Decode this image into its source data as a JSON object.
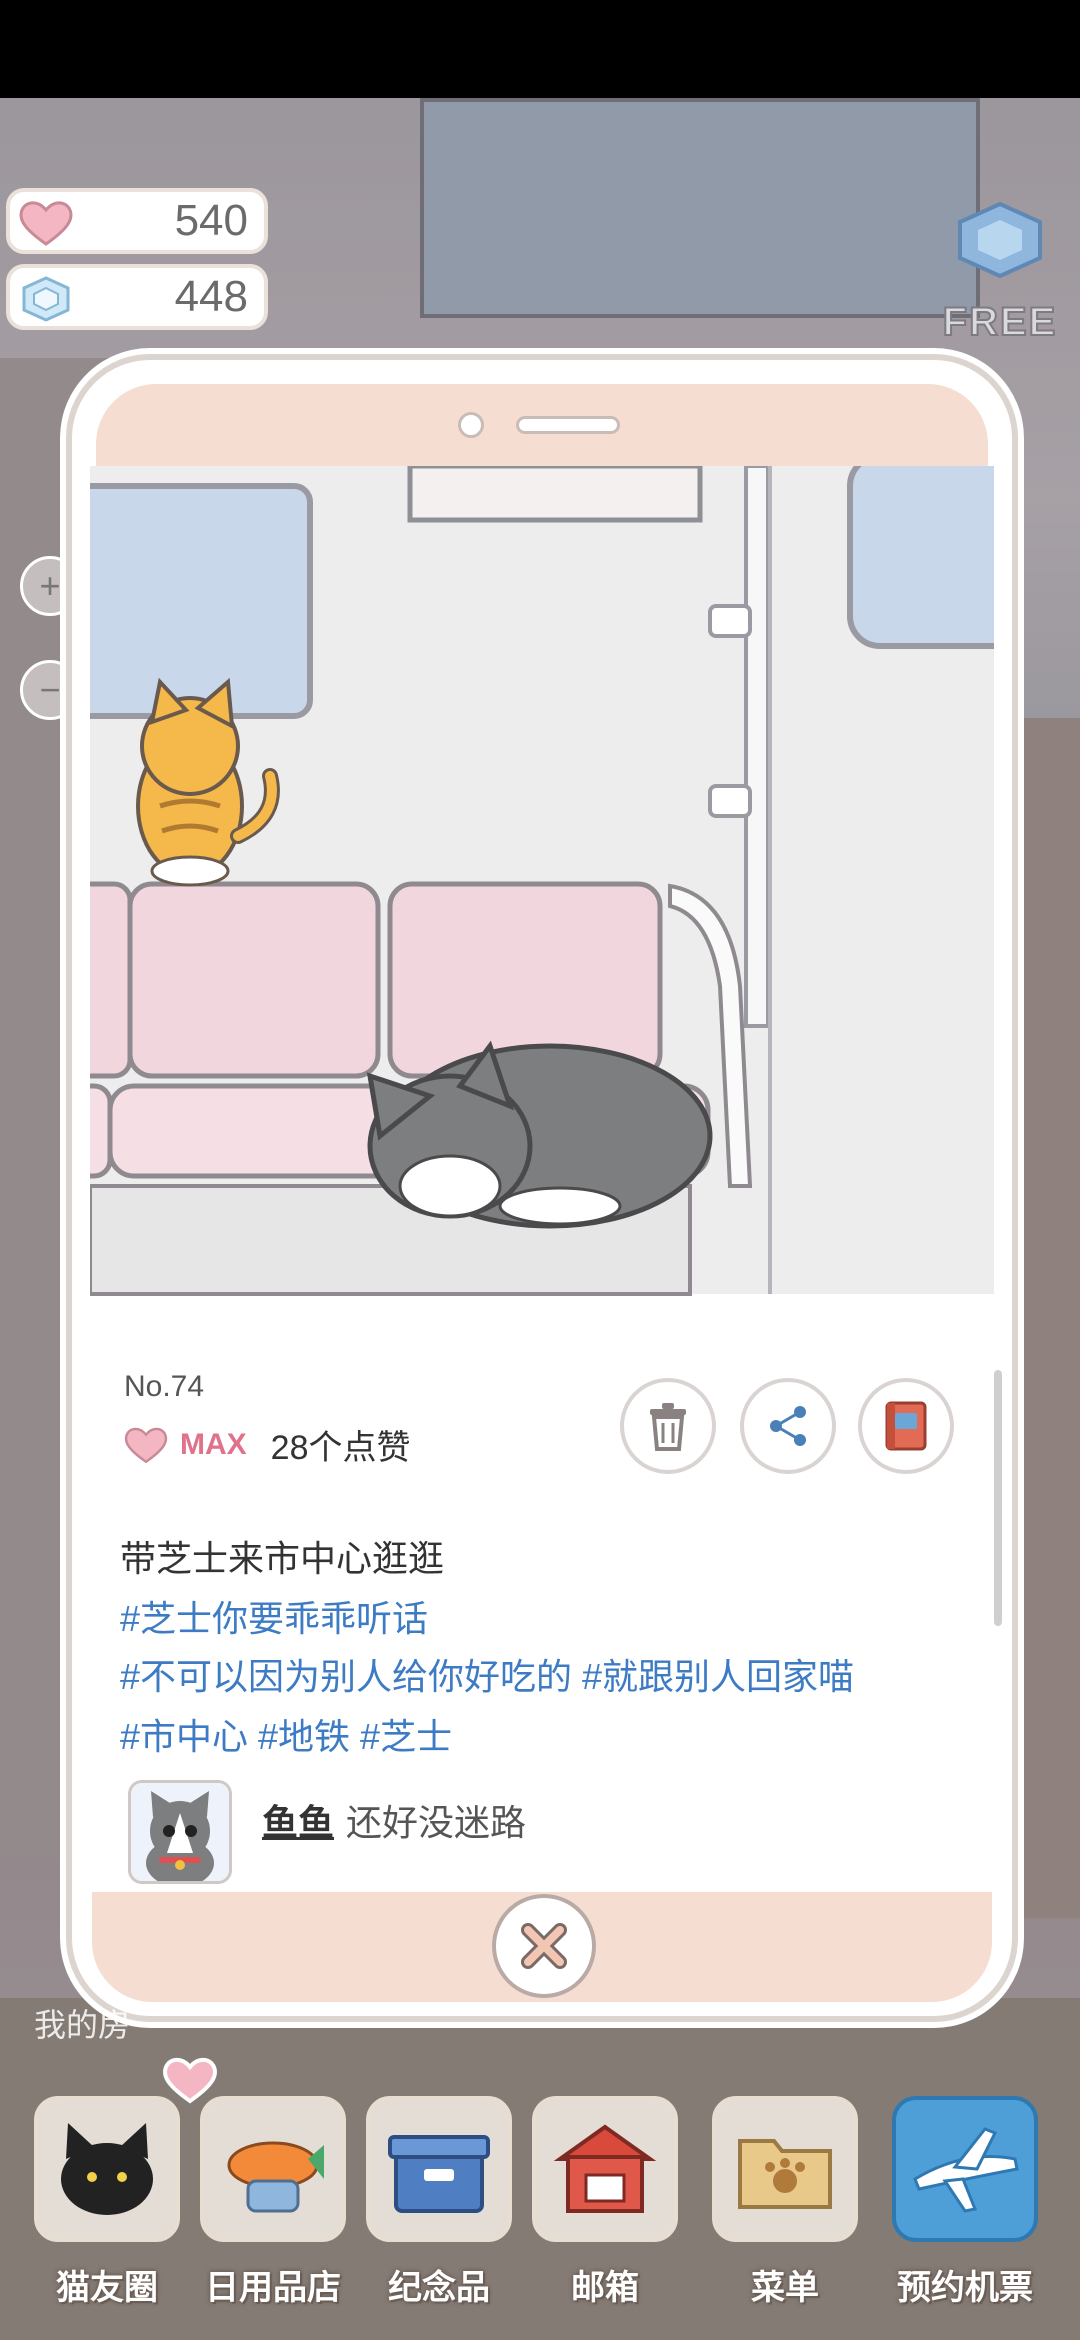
{
  "hud": {
    "hearts": "540",
    "gems": "448",
    "free_label": "FREE",
    "zoom_in": "+",
    "zoom_out": "−"
  },
  "post": {
    "number": "No.74",
    "like_level": "MAX",
    "like_count": "28个点赞",
    "caption": "带芝士来市中心逛逛",
    "tags_line1": "#芝士你要乖乖听话",
    "tags_line2": "#不可以因为别人给你好吃的 #就跟别人回家喵",
    "tags_line3": "#市中心 #地铁 #芝士",
    "actions": [
      "trash-icon",
      "share-icon",
      "album-icon"
    ]
  },
  "comment": {
    "author": "鱼鱼",
    "text": "还好没迷路"
  },
  "room_label": "我的房",
  "nav": {
    "items": [
      {
        "label": "猫友圈",
        "icon": "black-cat-icon"
      },
      {
        "label": "日用品店",
        "icon": "shop-icon"
      },
      {
        "label": "纪念品",
        "icon": "box-icon"
      },
      {
        "label": "邮箱",
        "icon": "mailbox-icon"
      },
      {
        "label": "菜单",
        "icon": "folder-icon"
      },
      {
        "label": "预约机票",
        "icon": "airplane-icon"
      }
    ]
  },
  "colors": {
    "phone_accent": "#f6ddd2",
    "tag_blue": "#3d7bc4",
    "max_pink": "#e0728a"
  }
}
